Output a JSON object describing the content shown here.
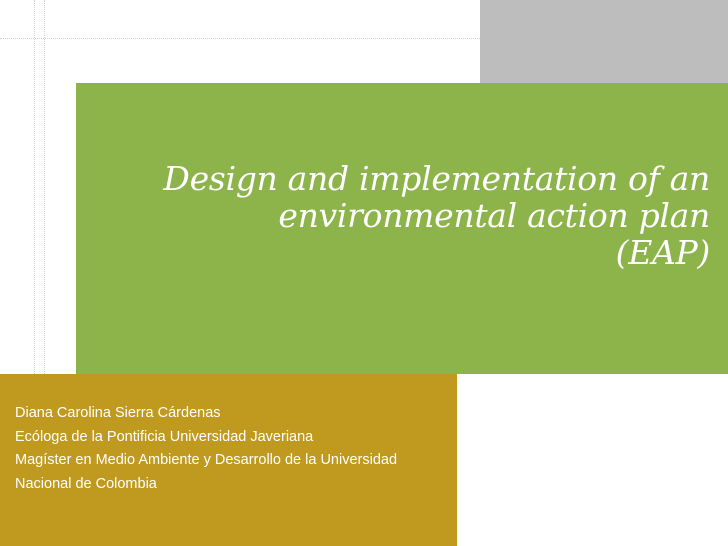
{
  "slide": {
    "title_lines": [
      "Design and implementation of an",
      "environmental action plan",
      "(EAP)"
    ],
    "author_lines": [
      "Diana Carolina Sierra Cárdenas",
      "Ecóloga de la Pontificia Universidad Javeriana",
      "Magíster en Medio Ambiente y Desarrollo de la Universidad",
      "Nacional de Colombia"
    ]
  },
  "colors": {
    "green": "#8db34b",
    "gold": "#bf9a1f",
    "gray": "#bdbdbd",
    "white": "#ffffff"
  }
}
